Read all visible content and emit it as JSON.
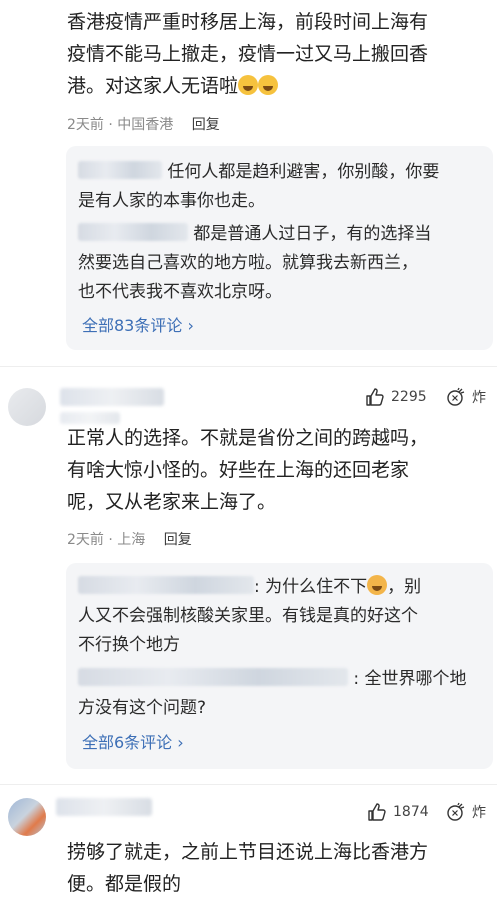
{
  "comment1": {
    "lines": [
      "香港疫情严重时移居上海，前段时间上海有",
      "疫情不能马上撤走，疫情一过又马上搬回香",
      "港。对这家人无语啦"
    ],
    "time": "2天前",
    "location": "中国香港",
    "reply": "回复",
    "replies": [
      {
        "lines": [
          "任何人都是趋利避害，你别酸，你要",
          "是有人家的本事你也走。"
        ]
      },
      {
        "lines": [
          "都是普通人过日子，有的选择当",
          "然要选自己喜欢的地方啦。就算我去新西兰，",
          "也不代表我不喜欢北京呀。"
        ]
      }
    ],
    "more": "全部83条评论 ›"
  },
  "comment2": {
    "likes": "2295",
    "bomb": "炸",
    "lines": [
      "正常人的选择。不就是省份之间的跨越吗，",
      "有啥大惊小怪的。好些在上海的还回老家",
      "呢，又从老家来上海了。"
    ],
    "time": "2天前",
    "location": "上海",
    "reply": "回复",
    "replies": [
      {
        "lines": [
          ": 为什么住不下",
          "，别",
          "人又不会强制核酸关家里。有钱是真的好这个",
          "不行换个地方"
        ]
      },
      {
        "lines": [
          ": 全世界哪个地",
          "方没有这个问题?"
        ]
      }
    ],
    "more": "全部6条评论 ›"
  },
  "comment3": {
    "likes": "1874",
    "bomb": "炸",
    "lines": [
      "捞够了就走，之前上节目还说上海比香港方",
      "便。都是假的"
    ]
  }
}
